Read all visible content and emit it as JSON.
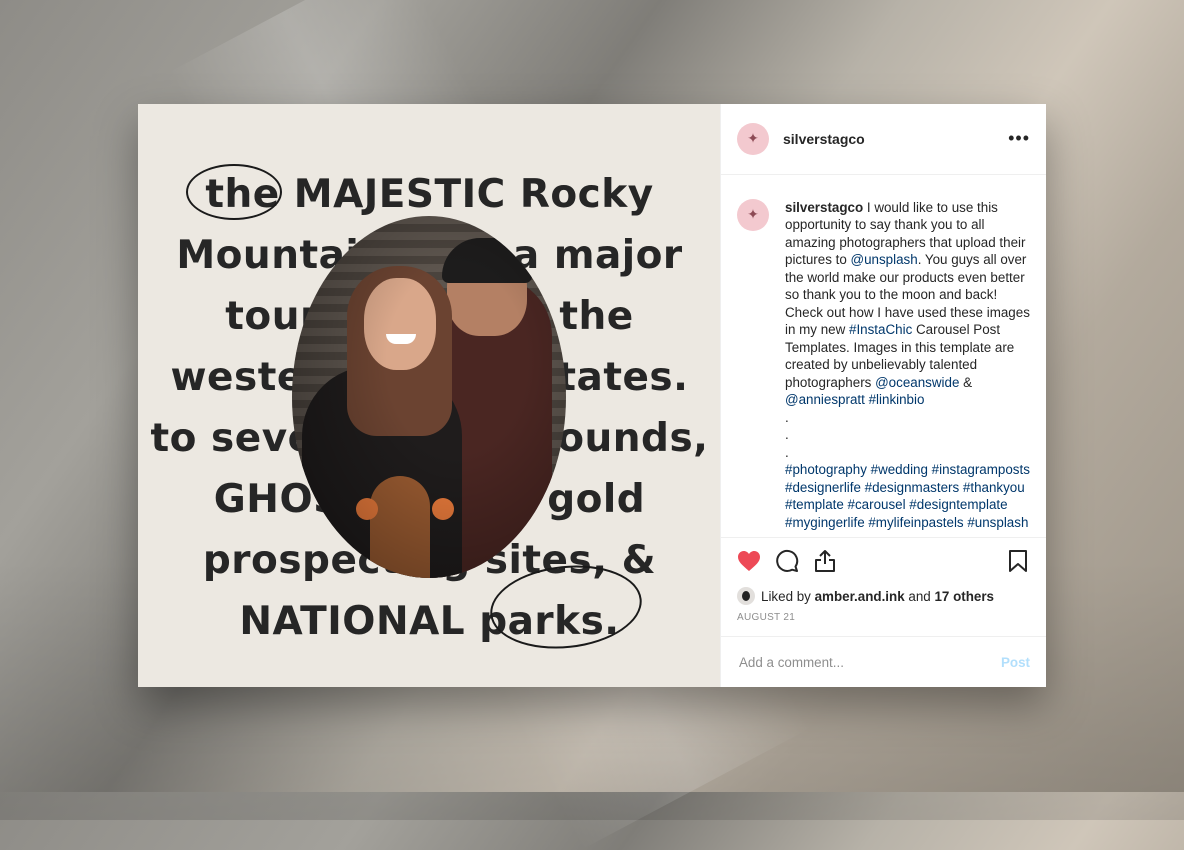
{
  "post": {
    "username": "silverstagco",
    "image_quote_lines": [
      "the MAJESTIC Rocky",
      "Mountains are a major",
      "tourist spot in the",
      "western United States.",
      "to several campgrounds,",
      "GHOST towns, gold",
      "prospecting sites, &",
      "NATIONAL parks."
    ],
    "caption": {
      "username": "silverstagco",
      "parts": [
        {
          "t": " I would like to use this opportunity to say thank you to all amazing photographers that upload their pictures to ",
          "link": false
        },
        {
          "t": "@unsplash",
          "link": true
        },
        {
          "t": ". You guys all over the world make our products even better so thank you to the moon and back! Check out how I have used these images in my new ",
          "link": false
        },
        {
          "t": "#InstaChic",
          "link": true
        },
        {
          "t": " Carousel Post Templates. Images in this template are created by unbelievably talented photographers ",
          "link": false
        },
        {
          "t": "@oceanswide",
          "link": true
        },
        {
          "t": " & ",
          "link": false
        },
        {
          "t": "@anniespratt",
          "link": true
        },
        {
          "t": " ",
          "link": false
        },
        {
          "t": "#linkinbio",
          "link": true
        }
      ],
      "dots": [
        ".",
        ".",
        "."
      ],
      "hashtags": "#photography #wedding #instagramposts #designerlife #designmasters #thankyou #template #carousel #designtemplate #mygingerlife #mylifeinpastels #unsplash"
    },
    "likes": {
      "prefix": "Liked by",
      "user": "amber.and.ink",
      "and": "and",
      "others": "17 others"
    },
    "date": "AUGUST 21",
    "comment_placeholder": "Add a comment...",
    "post_label": "Post",
    "more_label": "•••"
  }
}
